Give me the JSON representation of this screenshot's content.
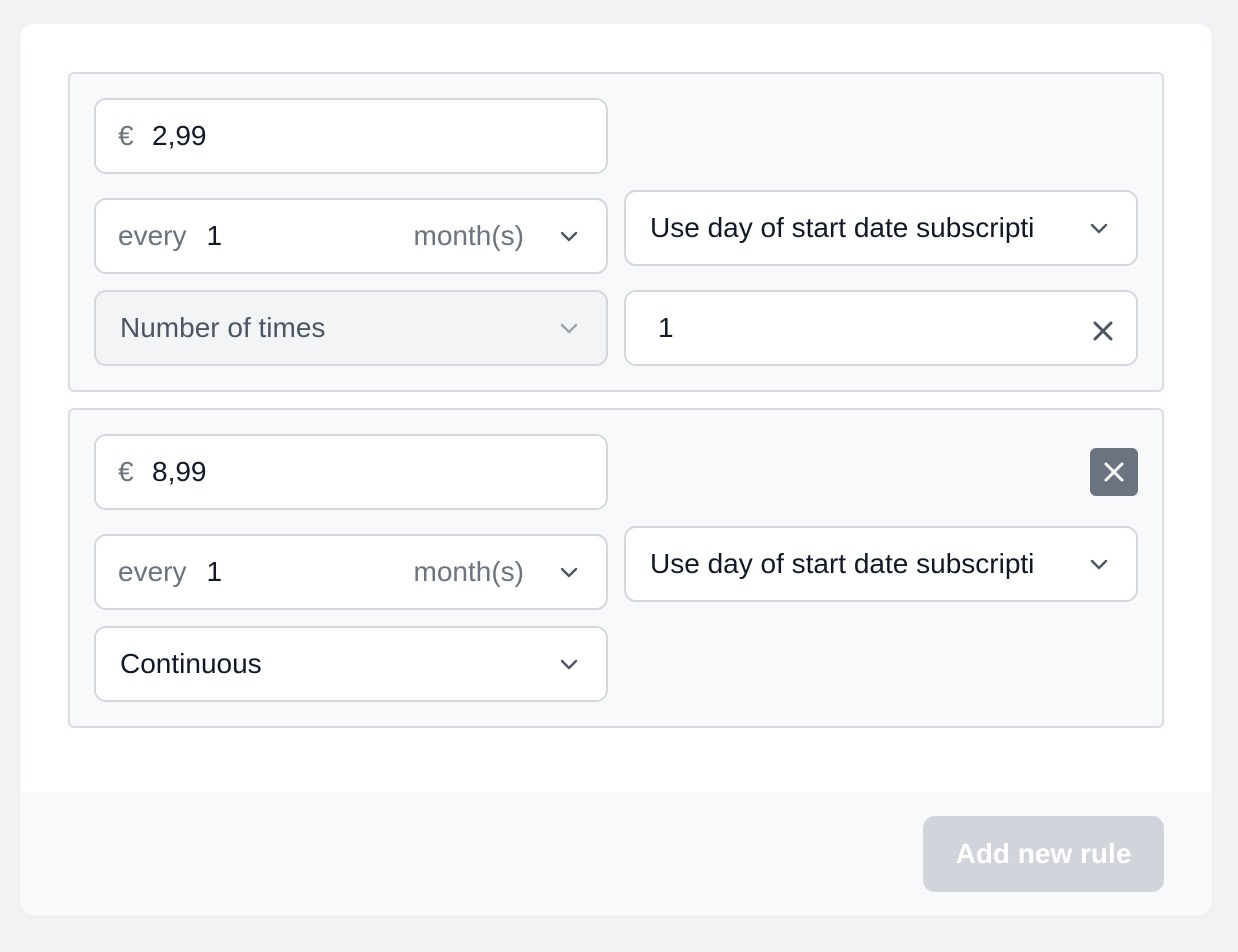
{
  "rules": [
    {
      "currency_symbol": "€",
      "amount": "2,99",
      "interval_label": "every",
      "interval_value": "1",
      "interval_unit": "month(s)",
      "billing_day": "Use day of start date subscripti",
      "duration_type": "Number of times",
      "times_value": "1"
    },
    {
      "currency_symbol": "€",
      "amount": "8,99",
      "interval_label": "every",
      "interval_value": "1",
      "interval_unit": "month(s)",
      "billing_day": "Use day of start date subscripti",
      "duration_type": "Continuous"
    }
  ],
  "footer": {
    "add_rule_label": "Add new rule"
  },
  "icons": {
    "dropdown": "chevron-down-icon",
    "clear": "close-icon",
    "remove": "close-icon"
  },
  "colors": {
    "page_bg": "#f2f3f5",
    "rule_bg": "#f8f9fb",
    "remove_button": "#6b7280",
    "add_button_disabled": "#d1d5db"
  }
}
